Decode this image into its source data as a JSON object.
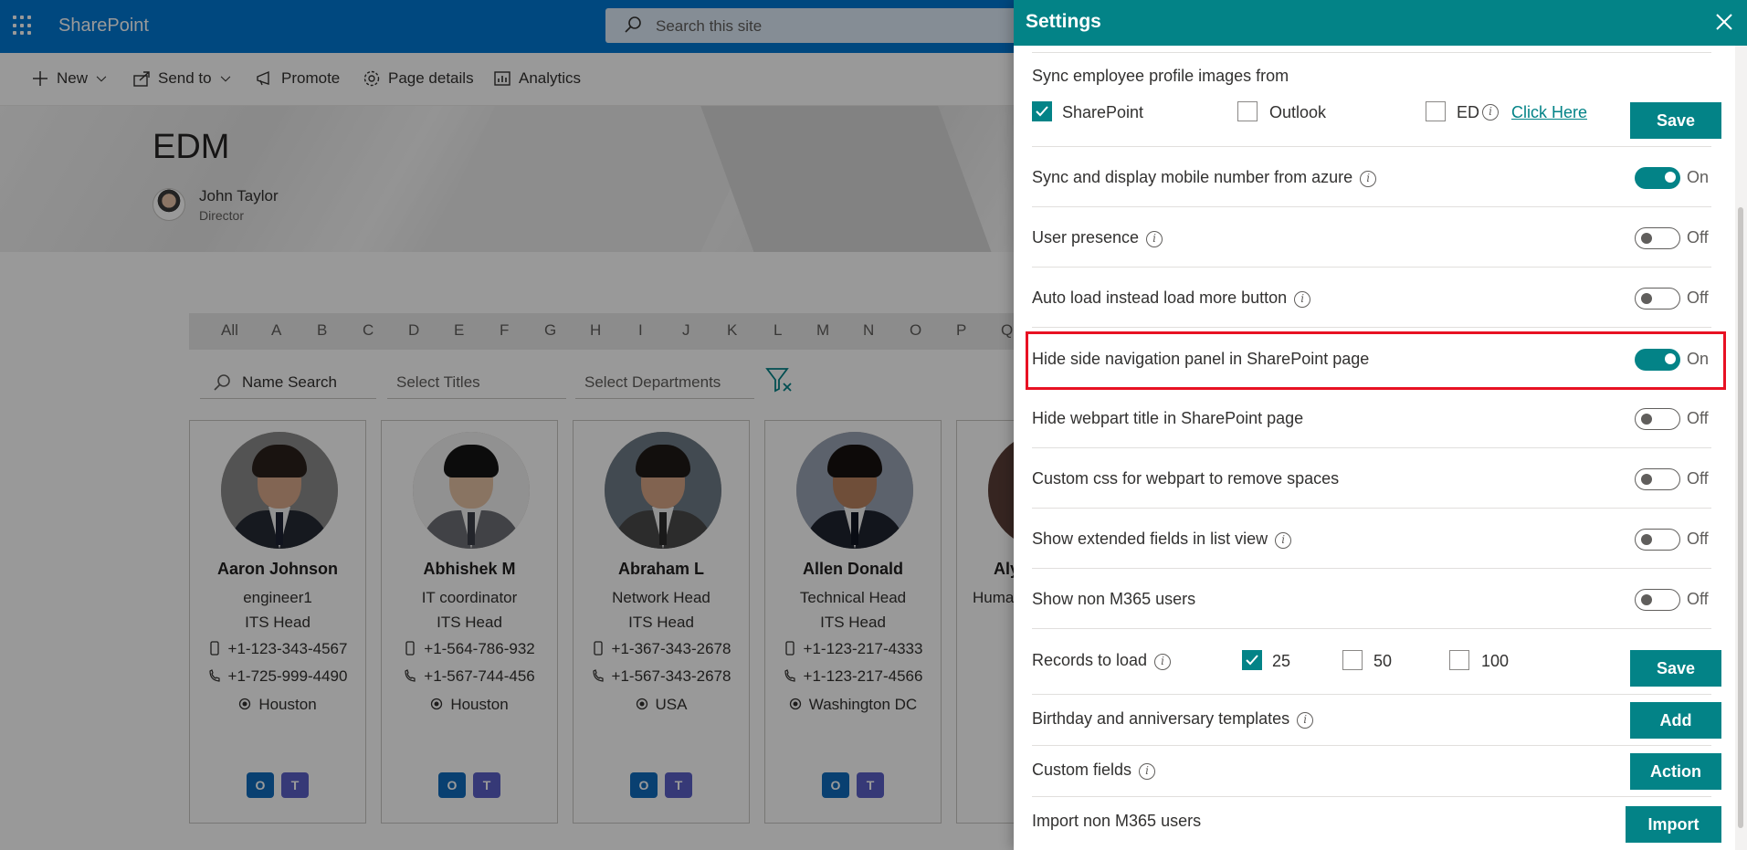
{
  "suite": {
    "brand": "SharePoint",
    "search_placeholder": "Search this site"
  },
  "commands": {
    "new": "New",
    "send_to": "Send to",
    "promote": "Promote",
    "page_details": "Page details",
    "analytics": "Analytics"
  },
  "page": {
    "title": "EDM",
    "author_name": "John Taylor",
    "author_role": "Director"
  },
  "alphabet": [
    "All",
    "A",
    "B",
    "C",
    "D",
    "E",
    "F",
    "G",
    "H",
    "I",
    "J",
    "K",
    "L",
    "M",
    "N",
    "O",
    "P",
    "Q"
  ],
  "filters": {
    "name_search": "Name Search",
    "titles": "Select Titles",
    "departments": "Select Departments"
  },
  "employees": [
    {
      "name": "Aaron Johnson",
      "title": "engineer1",
      "department": "ITS Head",
      "mobile": "+1-123-343-4567",
      "phone": "+1-725-999-4490",
      "location": "Houston"
    },
    {
      "name": "Abhishek M",
      "title": "IT coordinator",
      "department": "ITS Head",
      "mobile": "+1-564-786-932",
      "phone": "+1-567-744-456",
      "location": "Houston"
    },
    {
      "name": "Abraham L",
      "title": "Network Head",
      "department": "ITS Head",
      "mobile": "+1-367-343-2678",
      "phone": "+1-567-343-2678",
      "location": "USA"
    },
    {
      "name": "Allen Donald",
      "title": "Technical Head",
      "department": "ITS Head",
      "mobile": "+1-123-217-4333",
      "phone": "+1-123-217-4566",
      "location": "Washington DC"
    },
    {
      "name": "Aly",
      "title": "Human",
      "department": "",
      "mobile": "",
      "phone": "",
      "location": ""
    }
  ],
  "settings": {
    "title": "Settings",
    "sync_images": {
      "label": "Sync employee profile images from",
      "option_sharepoint": "SharePoint",
      "option_outlook": "Outlook",
      "option_ed": "ED",
      "link": "Click Here",
      "save": "Save",
      "sharepoint_checked": true,
      "outlook_checked": false,
      "ed_checked": false
    },
    "toggles": [
      {
        "label": "Sync and display mobile number from azure",
        "state": "On",
        "info": true
      },
      {
        "label": "User presence",
        "state": "Off",
        "info": true
      },
      {
        "label": "Auto load instead load more button",
        "state": "Off",
        "info": true
      },
      {
        "label": "Hide side navigation panel in SharePoint page",
        "state": "On",
        "info": false
      },
      {
        "label": "Hide webpart title in SharePoint page",
        "state": "Off",
        "info": false
      },
      {
        "label": "Custom css for webpart to remove spaces",
        "state": "Off",
        "info": false
      },
      {
        "label": "Show extended fields in list view",
        "state": "Off",
        "info": true
      },
      {
        "label": "Show non M365 users",
        "state": "Off",
        "info": false
      }
    ],
    "records": {
      "label": "Records to load",
      "opt25": "25",
      "opt50": "50",
      "opt100": "100",
      "selected": "25",
      "save": "Save"
    },
    "birthday": {
      "label": "Birthday and anniversary templates",
      "button": "Add"
    },
    "custom_fields": {
      "label": "Custom fields",
      "button": "Action"
    },
    "import": {
      "label": "Import non M365 users",
      "button": "Import"
    }
  },
  "colors": {
    "suite_blue": "#0078d4",
    "teal": "#038387",
    "highlight_red": "#e81123"
  }
}
